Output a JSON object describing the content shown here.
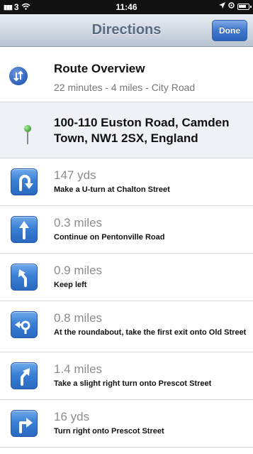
{
  "status_bar": {
    "carrier": "3",
    "time": "11:46",
    "right_icons": [
      "location-arrow-icon",
      "alarm-icon",
      "battery-icon"
    ]
  },
  "nav_bar": {
    "title": "Directions",
    "done_label": "Done"
  },
  "overview": {
    "title": "Route Overview",
    "summary": "22 minutes - 4 miles - City Road",
    "icon": "route-overview-icon"
  },
  "destination": {
    "address": "100-110 Euston Road, Camden Town, NW1 2SX, England",
    "icon": "map-pin-icon"
  },
  "steps": [
    {
      "distance": "147 yds",
      "instruction": "Make a U-turn at Chalton Street",
      "icon": "u-turn-icon"
    },
    {
      "distance": "0.3 miles",
      "instruction": "Continue on Pentonville Road",
      "icon": "straight-arrow-icon"
    },
    {
      "distance": "0.9 miles",
      "instruction": "Keep left",
      "icon": "keep-left-icon"
    },
    {
      "distance": "0.8 miles",
      "instruction": "At the roundabout, take the first exit onto Old Street",
      "icon": "roundabout-icon"
    },
    {
      "distance": "1.4 miles",
      "instruction": "Take a slight right turn onto Prescot Street",
      "icon": "slight-right-icon"
    },
    {
      "distance": "16 yds",
      "instruction": "Turn right onto Prescot Street",
      "icon": "turn-right-icon"
    }
  ],
  "colors": {
    "accent_blue": "#3a7fd6",
    "nav_title": "#5a6b82",
    "distance_gray": "#8c8c8c",
    "pin_green": "#3a9a2e"
  }
}
